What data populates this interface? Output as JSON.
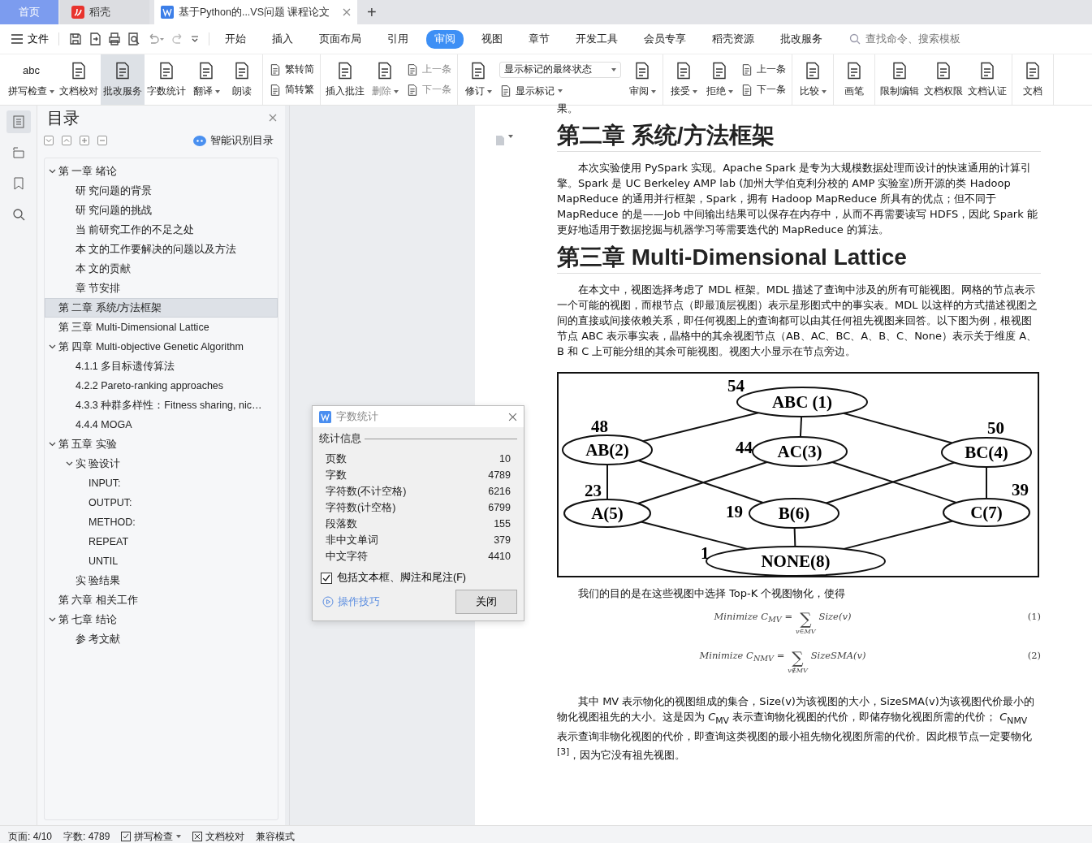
{
  "tabs": [
    {
      "label": "首页",
      "kind": "home",
      "selected": false
    },
    {
      "label": "稻壳",
      "kind": "app",
      "selected": false
    },
    {
      "label": "基于Python的...VS问题 课程论文",
      "kind": "document",
      "selected": true
    }
  ],
  "new_tab": "+",
  "menu": {
    "file": "文件",
    "items": [
      {
        "label": "开始",
        "selected": false
      },
      {
        "label": "插入",
        "selected": false
      },
      {
        "label": "页面布局",
        "selected": false
      },
      {
        "label": "引用",
        "selected": false
      },
      {
        "label": "审阅",
        "selected": true
      },
      {
        "label": "视图",
        "selected": false
      },
      {
        "label": "章节",
        "selected": false
      },
      {
        "label": "开发工具",
        "selected": false
      },
      {
        "label": "会员专享",
        "selected": false
      },
      {
        "label": "稻壳资源",
        "selected": false
      },
      {
        "label": "批改服务",
        "selected": false
      }
    ],
    "search": {
      "placeholder": "查找命令、搜索模板"
    }
  },
  "ribbon": [
    {
      "items": [
        {
          "kind": "large",
          "label": "拼写检查",
          "glyph": "abc",
          "dropdown": true,
          "disabled": false,
          "highlighted": false
        },
        {
          "kind": "large",
          "label": "文档校对",
          "dropdown": false,
          "disabled": false,
          "highlighted": false
        },
        {
          "kind": "large",
          "label": "批改服务",
          "dropdown": false,
          "disabled": false,
          "highlighted": true
        },
        {
          "kind": "large",
          "label": "字数统计",
          "dropdown": false,
          "disabled": false,
          "highlighted": false
        },
        {
          "kind": "large",
          "label": "翻译",
          "dropdown": true,
          "disabled": false,
          "highlighted": false
        },
        {
          "kind": "large",
          "label": "朗读",
          "dropdown": false,
          "disabled": false,
          "highlighted": false
        }
      ]
    },
    {
      "items": [
        {
          "kind": "stack",
          "entries": [
            {
              "kind": "button",
              "label": "繁转简",
              "dropdown": false,
              "disabled": false
            },
            {
              "kind": "button",
              "label": "简转繁",
              "dropdown": false,
              "disabled": false
            }
          ]
        }
      ]
    },
    {
      "items": [
        {
          "kind": "large",
          "label": "插入批注",
          "dropdown": false,
          "disabled": false,
          "highlighted": false
        },
        {
          "kind": "large",
          "label": "删除",
          "dropdown": true,
          "disabled": true,
          "highlighted": false
        },
        {
          "kind": "stack",
          "entries": [
            {
              "kind": "button",
              "label": "上一条",
              "dropdown": false,
              "disabled": true
            },
            {
              "kind": "button",
              "label": "下一条",
              "dropdown": false,
              "disabled": true
            }
          ]
        }
      ]
    },
    {
      "items": [
        {
          "kind": "large",
          "label": "修订",
          "dropdown": true,
          "disabled": false,
          "highlighted": false
        },
        {
          "kind": "stack",
          "entries": [
            {
              "kind": "select",
              "label": "显示标记的最终状态",
              "dropdown": true,
              "disabled": false
            },
            {
              "kind": "button",
              "label": "显示标记",
              "dropdown": true,
              "disabled": false
            }
          ]
        },
        {
          "kind": "large",
          "label": "审阅",
          "dropdown": true,
          "disabled": false,
          "highlighted": false
        }
      ]
    },
    {
      "items": [
        {
          "kind": "large",
          "label": "接受",
          "dropdown": true,
          "disabled": false,
          "highlighted": false
        },
        {
          "kind": "large",
          "label": "拒绝",
          "dropdown": true,
          "disabled": false,
          "highlighted": false
        },
        {
          "kind": "stack",
          "entries": [
            {
              "kind": "button",
              "label": "上一条",
              "dropdown": false,
              "disabled": false
            },
            {
              "kind": "button",
              "label": "下一条",
              "dropdown": false,
              "disabled": false
            }
          ]
        }
      ]
    },
    {
      "items": [
        {
          "kind": "large",
          "label": "比较",
          "dropdown": true,
          "disabled": false,
          "highlighted": false
        }
      ]
    },
    {
      "items": [
        {
          "kind": "large",
          "label": "画笔",
          "dropdown": false,
          "disabled": false,
          "highlighted": false
        }
      ]
    },
    {
      "items": [
        {
          "kind": "large",
          "label": "限制编辑",
          "dropdown": false,
          "disabled": false,
          "highlighted": false
        },
        {
          "kind": "large",
          "label": "文档权限",
          "dropdown": false,
          "disabled": false,
          "highlighted": false
        },
        {
          "kind": "large",
          "label": "文档认证",
          "dropdown": false,
          "disabled": false,
          "highlighted": false
        }
      ]
    },
    {
      "items": [
        {
          "kind": "large",
          "label": "文档",
          "dropdown": false,
          "disabled": false,
          "highlighted": false
        }
      ]
    }
  ],
  "nav_strip": [
    {
      "selected": true
    },
    {
      "selected": false
    },
    {
      "selected": false
    },
    {
      "selected": false
    }
  ],
  "toc": {
    "title": "目录",
    "smart_button": "智能识别目录",
    "items": [
      {
        "label": "第 一章 绪论",
        "selected": false,
        "expanded": true,
        "children": [
          {
            "label": "研 究问题的背景",
            "selected": false
          },
          {
            "label": "研 究问题的挑战",
            "selected": false
          },
          {
            "label": "当 前研究工作的不足之处",
            "selected": false
          },
          {
            "label": "本 文的工作要解决的问题以及方法",
            "selected": false
          },
          {
            "label": "本 文的贡献",
            "selected": false
          },
          {
            "label": "章 节安排",
            "selected": false
          }
        ]
      },
      {
        "label": "第 二章 系统/方法框架",
        "selected": true
      },
      {
        "label": "第 三章 Multi-Dimensional Lattice",
        "selected": false
      },
      {
        "label": "第 四章 Multi-objective Genetic Algorithm",
        "selected": false,
        "expanded": true,
        "children": [
          {
            "label": "4.1.1 多目标遗传算法",
            "selected": false
          },
          {
            "label": "4.2.2 Pareto-ranking approaches",
            "selected": false
          },
          {
            "label": "4.3.3 种群多样性：Fitness sharing, nic…",
            "selected": false
          },
          {
            "label": "4.4.4 MOGA",
            "selected": false
          }
        ]
      },
      {
        "label": "第 五章 实验",
        "selected": false,
        "expanded": true,
        "children": [
          {
            "label": "实 验设计",
            "selected": false,
            "expanded": true,
            "children": [
              {
                "label": "INPUT:",
                "selected": false
              },
              {
                "label": "OUTPUT:",
                "selected": false
              },
              {
                "label": "METHOD:",
                "selected": false
              },
              {
                "label": "REPEAT",
                "selected": false
              },
              {
                "label": "UNTIL",
                "selected": false
              }
            ]
          },
          {
            "label": "实 验结果",
            "selected": false
          }
        ]
      },
      {
        "label": "第 六章 相关工作",
        "selected": false
      },
      {
        "label": "第 七章 结论",
        "selected": false,
        "expanded": true,
        "children": [
          {
            "label": "参 考文献",
            "selected": false
          }
        ]
      }
    ]
  },
  "dialog": {
    "title": "字数统计",
    "section": "统计信息",
    "rows": [
      {
        "label": "页数",
        "value": "10"
      },
      {
        "label": "字数",
        "value": "4789"
      },
      {
        "label": "字符数(不计空格)",
        "value": "6216"
      },
      {
        "label": "字符数(计空格)",
        "value": "6799"
      },
      {
        "label": "段落数",
        "value": "155"
      },
      {
        "label": "非中文单词",
        "value": "379"
      },
      {
        "label": "中文字符",
        "value": "4410"
      }
    ],
    "checkbox": {
      "label": "包括文本框、脚注和尾注(F)",
      "checked": true
    },
    "tips_link": "操作技巧",
    "close_button": "关闭"
  },
  "document": {
    "blocks": [
      {
        "kind": "fragment",
        "text": "果。"
      },
      {
        "kind": "heading",
        "text": "第二章 系统/方法框架"
      },
      {
        "kind": "paragraph",
        "text": "本次实验使用 PySpark 实现。Apache Spark 是专为大规模数据处理而设计的快速通用的计算引擎。Spark 是 UC Berkeley AMP lab (加州大学伯克利分校的 AMP 实验室)所开源的类 Hadoop MapReduce 的通用并行框架，Spark，拥有 Hadoop MapReduce 所具有的优点；但不同于 MapReduce 的是——Job 中间输出结果可以保存在内存中，从而不再需要读写 HDFS，因此 Spark 能更好地适用于数据挖掘与机器学习等需要迭代的 MapReduce 的算法。"
      },
      {
        "kind": "heading",
        "text": "第三章 Multi-Dimensional Lattice"
      },
      {
        "kind": "paragraph",
        "text": "在本文中，视图选择考虑了 MDL 框架。MDL 描述了查询中涉及的所有可能视图。网格的节点表示一个可能的视图，而根节点（即最顶层视图）表示星形图式中的事实表。MDL 以这样的方式描述视图之间的直接或间接依赖关系，即任何视图上的查询都可以由其任何祖先视图来回答。以下图为例，根视图节点 ABC 表示事实表，晶格中的其余视图节点（AB、AC、BC、A、B、C、None）表示关于维度 A、B 和 C 上可能分组的其余可能视图。视图大小显示在节点旁边。"
      },
      {
        "kind": "figure",
        "nodes": [
          {
            "label": "ABC (1)",
            "weight": "54"
          },
          {
            "label": "AB(2)",
            "weight": "48"
          },
          {
            "label": "AC(3)",
            "weight": "44"
          },
          {
            "label": "BC(4)",
            "weight": "50"
          },
          {
            "label": "A(5)",
            "weight": "23"
          },
          {
            "label": "B(6)",
            "weight": "19"
          },
          {
            "label": "C(7)",
            "weight": "39"
          },
          {
            "label": "NONE(8)",
            "weight": "1"
          }
        ]
      },
      {
        "kind": "paragraph",
        "text": "我们的目的是在这些视图中选择 Top-K 个视图物化，使得"
      },
      {
        "kind": "equation",
        "lhs": "Minimize C$_{MV}$ =",
        "operator": "∑",
        "under": "v∈MV",
        "rhs": "Size(v)",
        "number": "(1)"
      },
      {
        "kind": "equation",
        "lhs": "Minimize C$_{NMV}$ =",
        "operator": "∑",
        "under": "v∉MV",
        "rhs": "SizeSMA(v)",
        "number": "(2)"
      },
      {
        "kind": "paragraph",
        "text": "其中 MV 表示物化的视图组成的集合，Size(v)为该视图的大小，SizeSMA(v)为该视图代价最小的物化视图祖先的大小。这是因为 *C*$_{MV}$ 表示查询物化视图的代价，即储存物化视图所需的代价； *C*$_{NMV}$ 表示查询非物化视图的代价，即查询这类视图的最小祖先物化视图所需的代价。因此根节点一定要物化$^{[3]}$，因为它没有祖先视图。"
      }
    ]
  },
  "status_bar": {
    "page": "页面: 4/10",
    "words": "字数: 4789",
    "spellcheck": "拼写检查",
    "proofread": "文档校对",
    "mode": "兼容模式"
  }
}
